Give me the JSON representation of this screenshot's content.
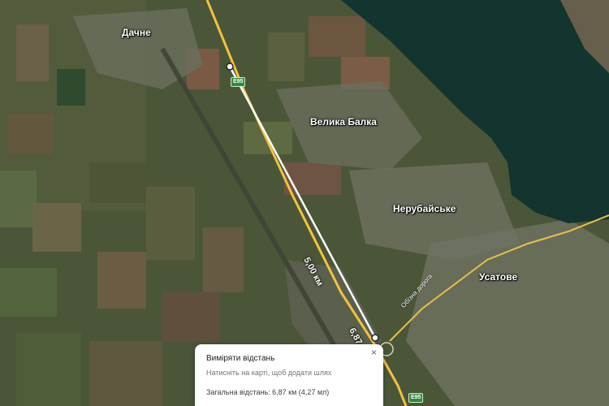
{
  "places": {
    "dachne": "Дачне",
    "velyka_balka": "Велика Балка",
    "nerubaiske": "Нерубайське",
    "usatove": "Усатове"
  },
  "road": {
    "shield_top": "E95",
    "shield_bottom": "E95",
    "bypass_label": "Обїзна дорога"
  },
  "measurement": {
    "segment_label": "5,00 км",
    "end_label": "6,87"
  },
  "card": {
    "title": "Виміряти відстань",
    "hint": "Натисніть на карті, щоб додати шлях",
    "total": "Загальна відстань: 6,87 км (4,27 мл)",
    "close_glyph": "×"
  },
  "colors": {
    "water": "#13342f",
    "road": "#f2c23e",
    "measure_line": "#ffffff"
  }
}
